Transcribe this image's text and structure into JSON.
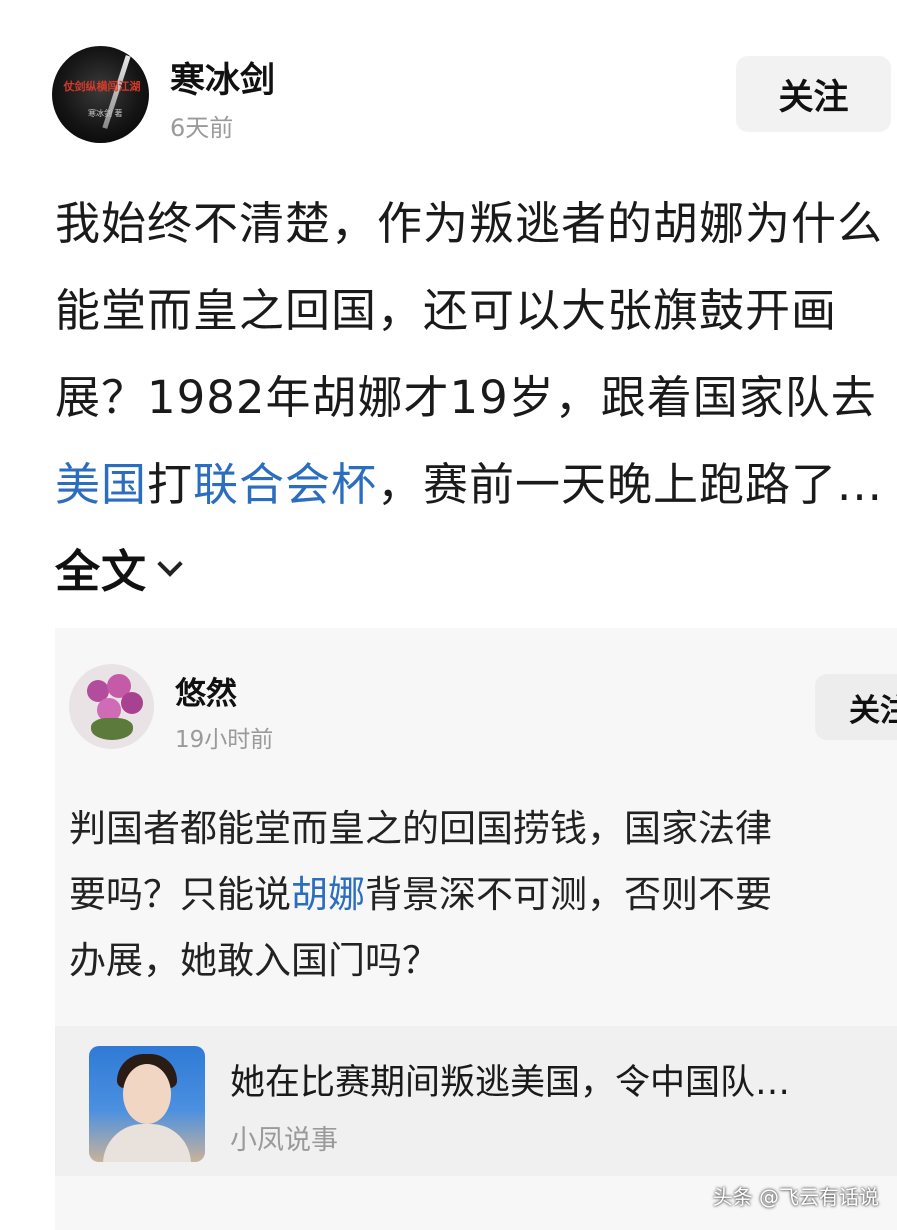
{
  "post": {
    "author": "寒冰剑",
    "time": "6天前",
    "follow_label": "关注",
    "avatar_text": "仗剑纵横闯江湖",
    "avatar_subtext": "寒冰剑 著",
    "body_part1": "我始终不清楚，作为叛逃者的胡娜为什么能堂而皇之回国，还可以大张旗鼓开画展？1982年胡娜才19岁，跟着国家队去",
    "link1": "美国",
    "body_part2": "打",
    "link2": "联合会杯",
    "body_part3": "，赛前一天晚上跑路了...",
    "more_label": "全文"
  },
  "quote": {
    "author": "悠然",
    "time": "19小时前",
    "follow_label": "关注",
    "line1": "判国者都能堂而皇之的回国捞钱，国家法律",
    "line2_pre": "要吗？只能说",
    "line2_link": "胡娜",
    "line2_post": "背景深不可测，否则不要",
    "line3": "办展，她敢入国门吗？",
    "ref": {
      "title": "她在比赛期间叛逃美国，令中国队…",
      "source": "小凤说事"
    }
  },
  "watermark": "头条 @飞云有话说",
  "colors": {
    "link": "#2b6dbf",
    "muted": "#9a9a9a",
    "follow_bg": "#f2f2f2"
  }
}
